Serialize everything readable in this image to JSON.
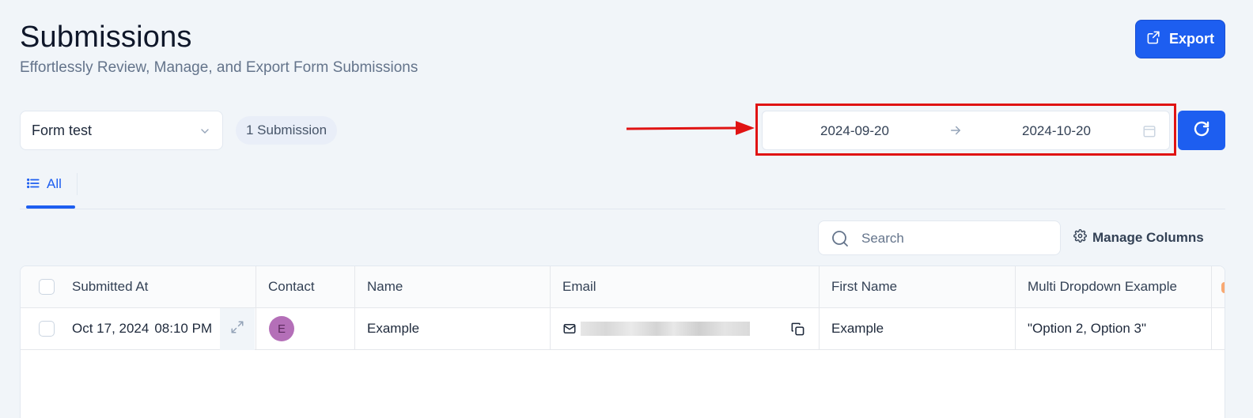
{
  "header": {
    "title": "Submissions",
    "subtitle": "Effortlessly Review, Manage, and Export Form Submissions",
    "export_label": "Export"
  },
  "filters": {
    "form_select_value": "Form test",
    "submission_count": "1 Submission",
    "date_start": "2024-09-20",
    "date_end": "2024-10-20"
  },
  "tabs": [
    {
      "label": "All",
      "active": true
    }
  ],
  "toolbar": {
    "search_placeholder": "Search",
    "manage_columns_label": "Manage Columns"
  },
  "table": {
    "columns": [
      "Submitted At",
      "Contact",
      "Name",
      "Email",
      "First Name",
      "Multi Dropdown Example"
    ],
    "rows": [
      {
        "submitted_date": "Oct 17, 2024",
        "submitted_time": "08:10 PM",
        "contact_initial": "E",
        "name": "Example",
        "email": "",
        "first_name": "Example",
        "multi_dropdown": "\"Option 2, Option 3\""
      }
    ]
  },
  "colors": {
    "accent": "#1d5ef0",
    "highlight": "#e01313",
    "avatar": "#b46fb8"
  }
}
